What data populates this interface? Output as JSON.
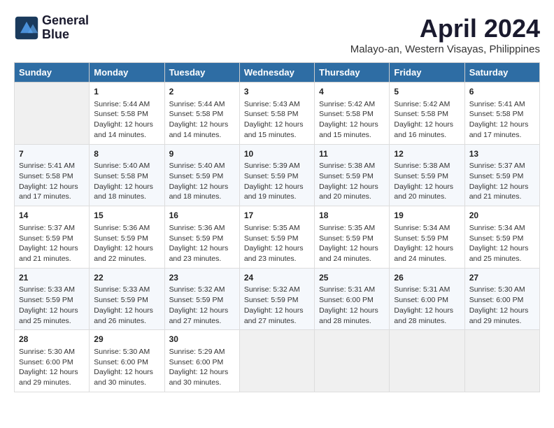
{
  "logo": {
    "line1": "General",
    "line2": "Blue"
  },
  "title": "April 2024",
  "subtitle": "Malayo-an, Western Visayas, Philippines",
  "header_days": [
    "Sunday",
    "Monday",
    "Tuesday",
    "Wednesday",
    "Thursday",
    "Friday",
    "Saturday"
  ],
  "weeks": [
    [
      {
        "num": "",
        "info": ""
      },
      {
        "num": "1",
        "info": "Sunrise: 5:44 AM\nSunset: 5:58 PM\nDaylight: 12 hours\nand 14 minutes."
      },
      {
        "num": "2",
        "info": "Sunrise: 5:44 AM\nSunset: 5:58 PM\nDaylight: 12 hours\nand 14 minutes."
      },
      {
        "num": "3",
        "info": "Sunrise: 5:43 AM\nSunset: 5:58 PM\nDaylight: 12 hours\nand 15 minutes."
      },
      {
        "num": "4",
        "info": "Sunrise: 5:42 AM\nSunset: 5:58 PM\nDaylight: 12 hours\nand 15 minutes."
      },
      {
        "num": "5",
        "info": "Sunrise: 5:42 AM\nSunset: 5:58 PM\nDaylight: 12 hours\nand 16 minutes."
      },
      {
        "num": "6",
        "info": "Sunrise: 5:41 AM\nSunset: 5:58 PM\nDaylight: 12 hours\nand 17 minutes."
      }
    ],
    [
      {
        "num": "7",
        "info": "Sunrise: 5:41 AM\nSunset: 5:58 PM\nDaylight: 12 hours\nand 17 minutes."
      },
      {
        "num": "8",
        "info": "Sunrise: 5:40 AM\nSunset: 5:58 PM\nDaylight: 12 hours\nand 18 minutes."
      },
      {
        "num": "9",
        "info": "Sunrise: 5:40 AM\nSunset: 5:59 PM\nDaylight: 12 hours\nand 18 minutes."
      },
      {
        "num": "10",
        "info": "Sunrise: 5:39 AM\nSunset: 5:59 PM\nDaylight: 12 hours\nand 19 minutes."
      },
      {
        "num": "11",
        "info": "Sunrise: 5:38 AM\nSunset: 5:59 PM\nDaylight: 12 hours\nand 20 minutes."
      },
      {
        "num": "12",
        "info": "Sunrise: 5:38 AM\nSunset: 5:59 PM\nDaylight: 12 hours\nand 20 minutes."
      },
      {
        "num": "13",
        "info": "Sunrise: 5:37 AM\nSunset: 5:59 PM\nDaylight: 12 hours\nand 21 minutes."
      }
    ],
    [
      {
        "num": "14",
        "info": "Sunrise: 5:37 AM\nSunset: 5:59 PM\nDaylight: 12 hours\nand 21 minutes."
      },
      {
        "num": "15",
        "info": "Sunrise: 5:36 AM\nSunset: 5:59 PM\nDaylight: 12 hours\nand 22 minutes."
      },
      {
        "num": "16",
        "info": "Sunrise: 5:36 AM\nSunset: 5:59 PM\nDaylight: 12 hours\nand 23 minutes."
      },
      {
        "num": "17",
        "info": "Sunrise: 5:35 AM\nSunset: 5:59 PM\nDaylight: 12 hours\nand 23 minutes."
      },
      {
        "num": "18",
        "info": "Sunrise: 5:35 AM\nSunset: 5:59 PM\nDaylight: 12 hours\nand 24 minutes."
      },
      {
        "num": "19",
        "info": "Sunrise: 5:34 AM\nSunset: 5:59 PM\nDaylight: 12 hours\nand 24 minutes."
      },
      {
        "num": "20",
        "info": "Sunrise: 5:34 AM\nSunset: 5:59 PM\nDaylight: 12 hours\nand 25 minutes."
      }
    ],
    [
      {
        "num": "21",
        "info": "Sunrise: 5:33 AM\nSunset: 5:59 PM\nDaylight: 12 hours\nand 25 minutes."
      },
      {
        "num": "22",
        "info": "Sunrise: 5:33 AM\nSunset: 5:59 PM\nDaylight: 12 hours\nand 26 minutes."
      },
      {
        "num": "23",
        "info": "Sunrise: 5:32 AM\nSunset: 5:59 PM\nDaylight: 12 hours\nand 27 minutes."
      },
      {
        "num": "24",
        "info": "Sunrise: 5:32 AM\nSunset: 5:59 PM\nDaylight: 12 hours\nand 27 minutes."
      },
      {
        "num": "25",
        "info": "Sunrise: 5:31 AM\nSunset: 6:00 PM\nDaylight: 12 hours\nand 28 minutes."
      },
      {
        "num": "26",
        "info": "Sunrise: 5:31 AM\nSunset: 6:00 PM\nDaylight: 12 hours\nand 28 minutes."
      },
      {
        "num": "27",
        "info": "Sunrise: 5:30 AM\nSunset: 6:00 PM\nDaylight: 12 hours\nand 29 minutes."
      }
    ],
    [
      {
        "num": "28",
        "info": "Sunrise: 5:30 AM\nSunset: 6:00 PM\nDaylight: 12 hours\nand 29 minutes."
      },
      {
        "num": "29",
        "info": "Sunrise: 5:30 AM\nSunset: 6:00 PM\nDaylight: 12 hours\nand 30 minutes."
      },
      {
        "num": "30",
        "info": "Sunrise: 5:29 AM\nSunset: 6:00 PM\nDaylight: 12 hours\nand 30 minutes."
      },
      {
        "num": "",
        "info": ""
      },
      {
        "num": "",
        "info": ""
      },
      {
        "num": "",
        "info": ""
      },
      {
        "num": "",
        "info": ""
      }
    ]
  ]
}
